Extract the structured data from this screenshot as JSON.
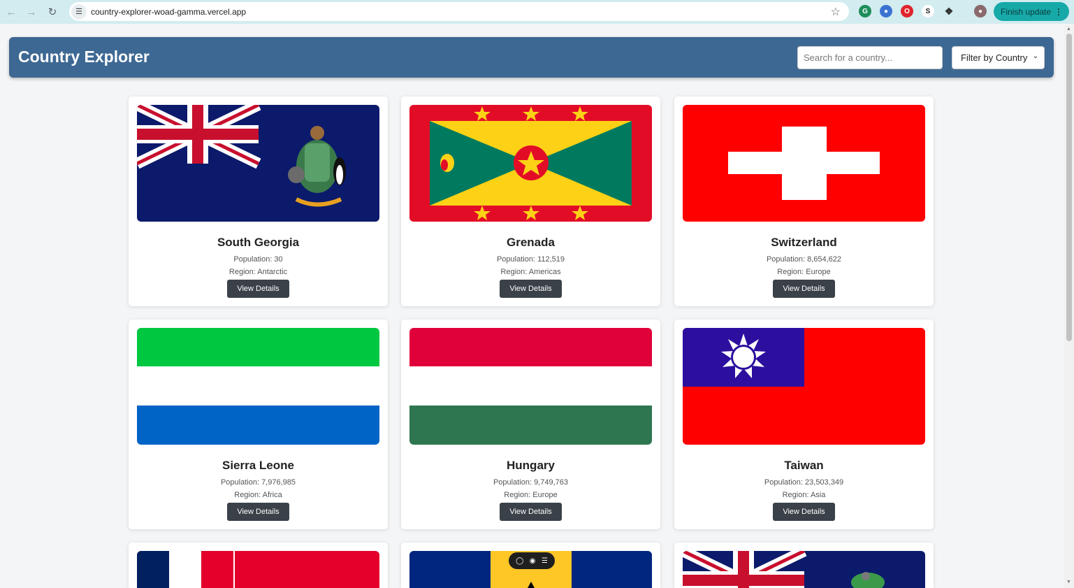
{
  "browser": {
    "url": "country-explorer-woad-gamma.vercel.app",
    "back_icon": "arrow-left-icon",
    "forward_icon": "arrow-right-icon",
    "reload_icon": "reload-icon",
    "finish_update_label": "Finish update"
  },
  "header": {
    "title": "Country Explorer",
    "search_placeholder": "Search for a country...",
    "filter_label": "Filter by Country"
  },
  "cards": [
    {
      "name": "South Georgia",
      "population": "Population: 30",
      "region": "Region: Antarctic",
      "button": "View Details"
    },
    {
      "name": "Grenada",
      "population": "Population: 112,519",
      "region": "Region: Americas",
      "button": "View Details"
    },
    {
      "name": "Switzerland",
      "population": "Population: 8,654,622",
      "region": "Region: Europe",
      "button": "View Details"
    },
    {
      "name": "Sierra Leone",
      "population": "Population: 7,976,985",
      "region": "Region: Africa",
      "button": "View Details"
    },
    {
      "name": "Hungary",
      "population": "Population: 9,749,763",
      "region": "Region: Europe",
      "button": "View Details"
    },
    {
      "name": "Taiwan",
      "population": "Population: 23,503,349",
      "region": "Region: Asia",
      "button": "View Details"
    }
  ],
  "colors": {
    "header_bg": "#3d6893",
    "button_bg": "#3a4149",
    "page_bg": "#f4f5f7"
  }
}
